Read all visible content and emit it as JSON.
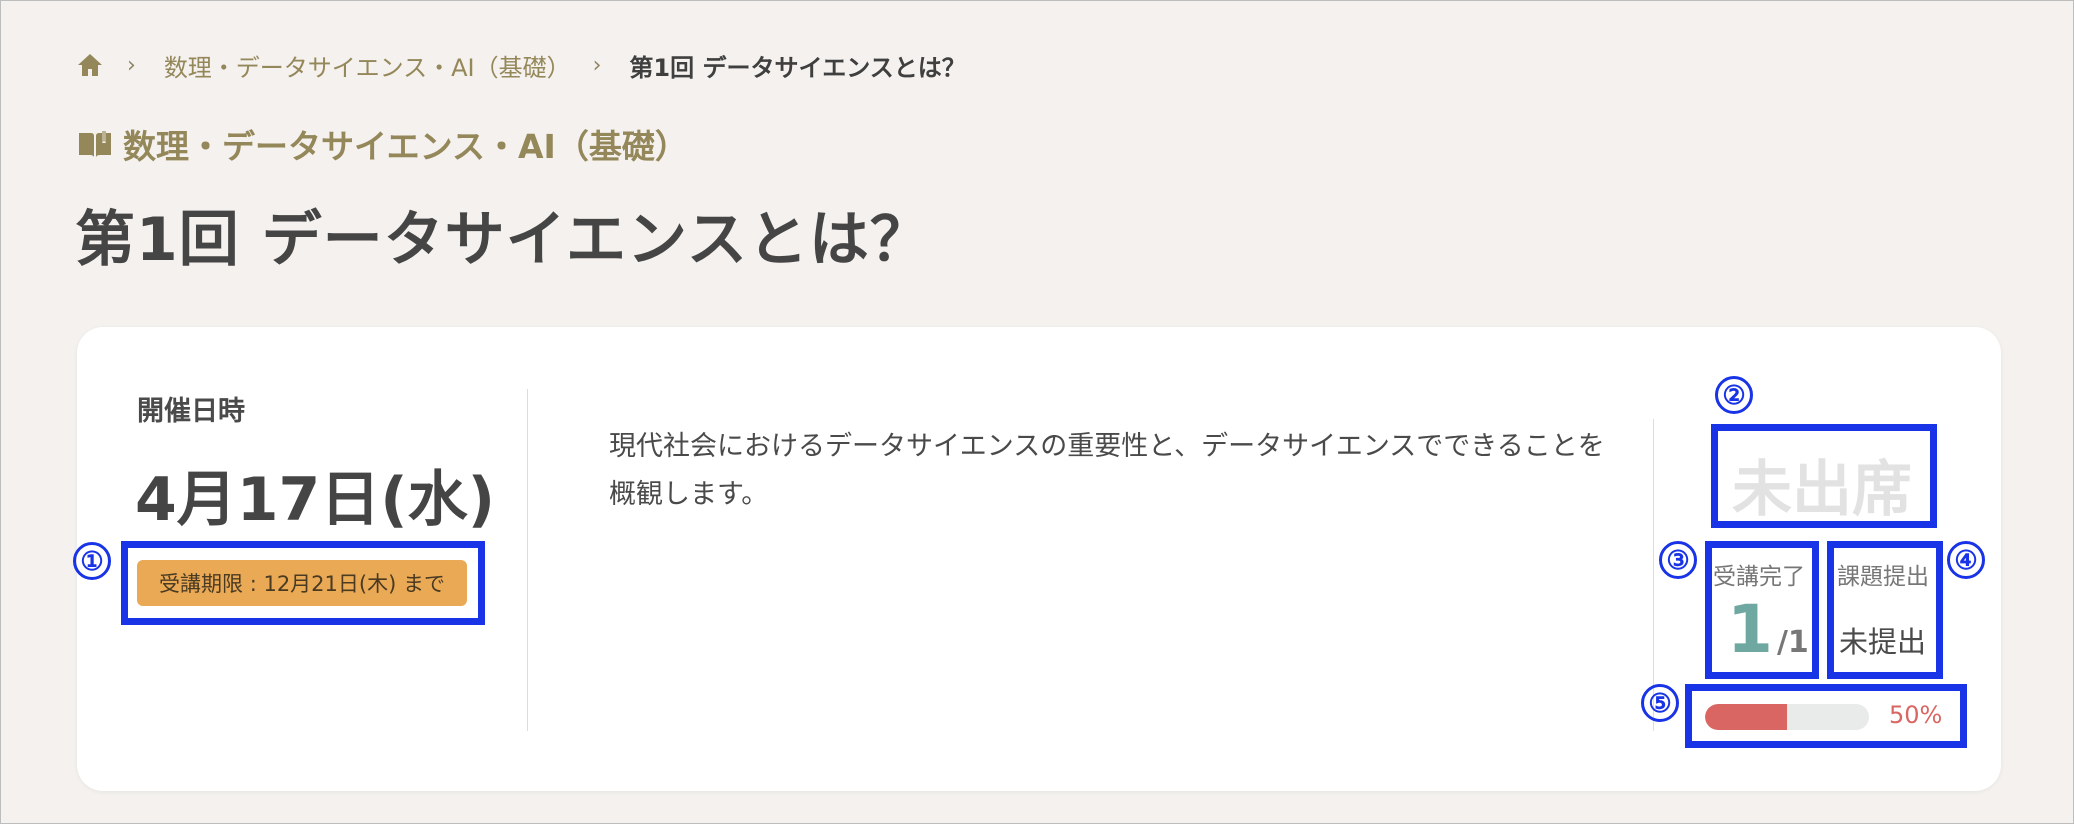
{
  "breadcrumb": {
    "home_icon": "home-icon",
    "course": "数理・データサイエンス・AI（基礎）",
    "current": "第1回 データサイエンスとは？"
  },
  "course_heading": {
    "icon": "book-icon",
    "title": "数理・データサイエンス・AI（基礎）"
  },
  "page_title": "第1回 データサイエンスとは？",
  "session": {
    "date_label": "開催日時",
    "date": "4月17日(水)",
    "deadline": "受講期限 : 12月21日(木) まで",
    "description": "現代社会におけるデータサイエンスの重要性と、データサイエンスでできることを概観します。"
  },
  "status": {
    "attendance": "未出席",
    "completion_label": "受講完了",
    "completion_done": "1",
    "completion_total": "/1",
    "submission_label": "課題提出",
    "submission_status": "未提出",
    "progress_percent": 50,
    "progress_text": "50%"
  },
  "annotations": {
    "m1": "①",
    "m2": "②",
    "m3": "③",
    "m4": "④",
    "m5": "⑤"
  },
  "colors": {
    "accent_gold": "#948759",
    "deadline_bg": "#e9a955",
    "completion_teal": "#6fa7a1",
    "progress_red": "#d96663",
    "highlight_blue": "#1834e6"
  }
}
